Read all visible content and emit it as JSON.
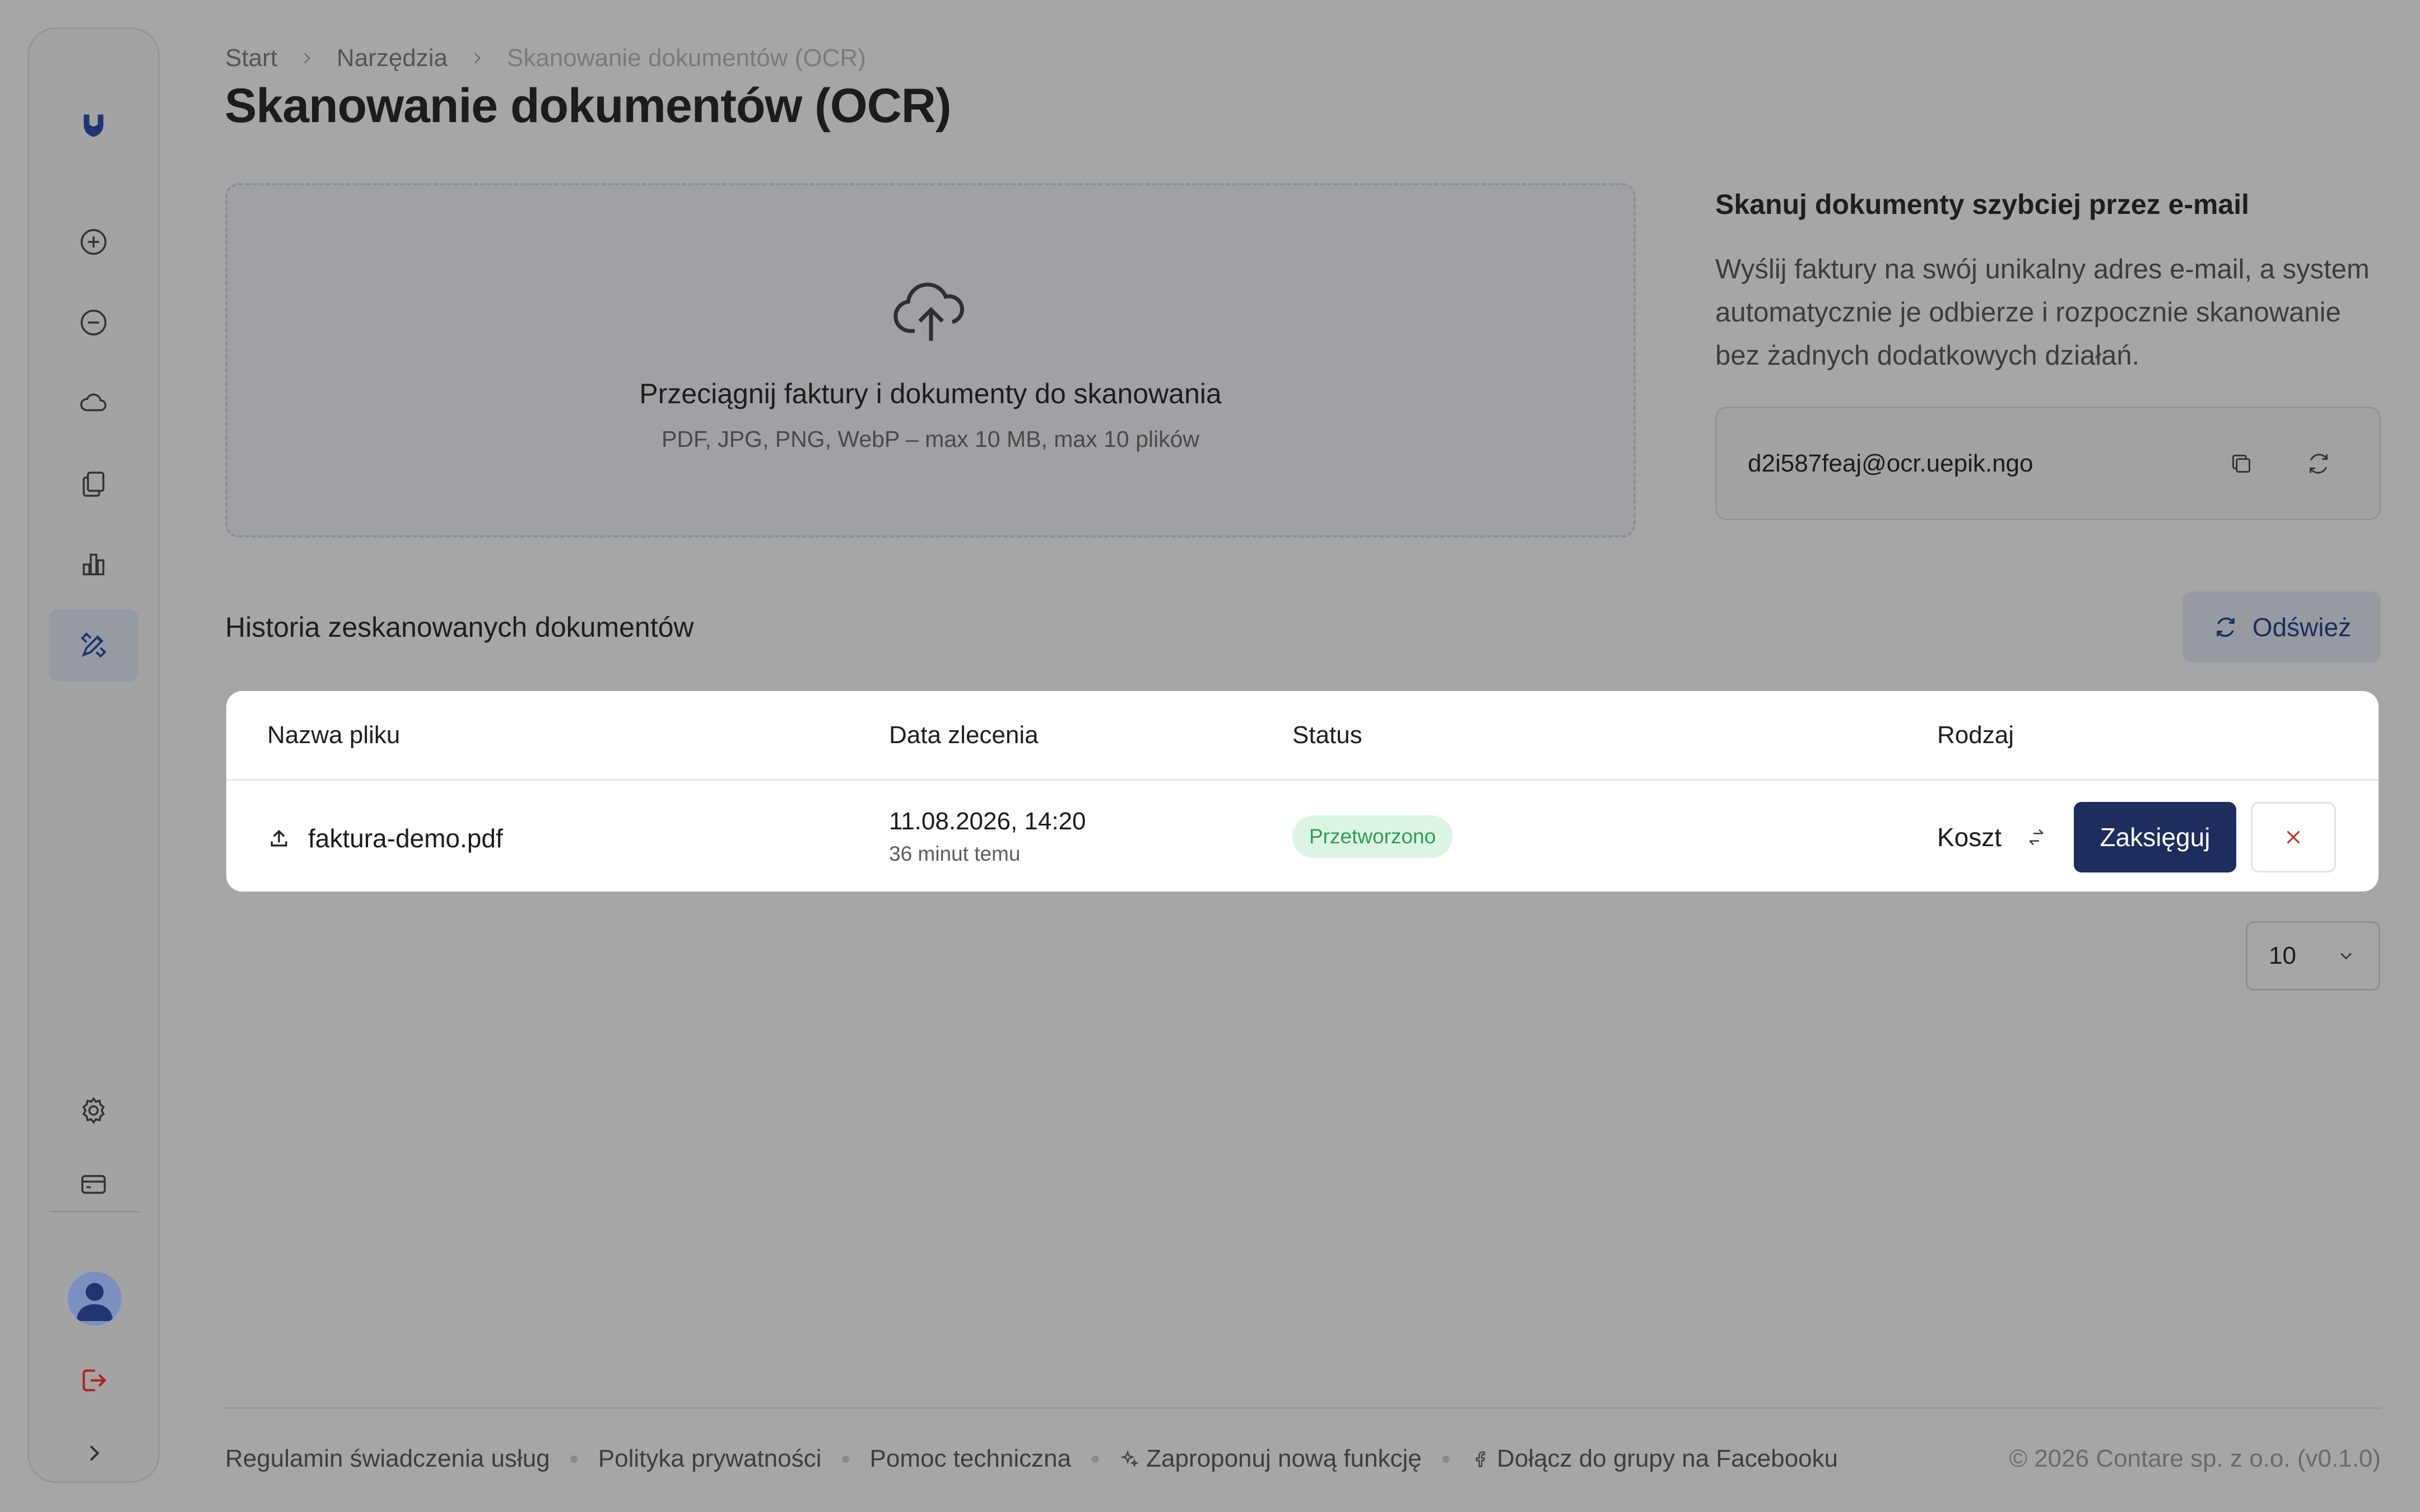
{
  "sidebar": {
    "items": [
      {
        "icon": "logo-icon"
      },
      {
        "icon": "plus-circle-icon"
      },
      {
        "icon": "minus-circle-icon"
      },
      {
        "icon": "cloud-icon"
      },
      {
        "icon": "documents-icon"
      },
      {
        "icon": "chart-bar-icon"
      },
      {
        "icon": "tools-icon",
        "active": true
      },
      {
        "icon": "gear-icon"
      },
      {
        "icon": "card-icon"
      },
      {
        "icon": "logout-icon"
      },
      {
        "icon": "chevron-right-icon"
      }
    ]
  },
  "breadcrumb": {
    "items": [
      "Start",
      "Narzędzia",
      "Skanowanie dokumentów (OCR)"
    ]
  },
  "page": {
    "title": "Skanowanie dokumentów (OCR)"
  },
  "upload": {
    "title": "Przeciągnij faktury i dokumenty do skanowania",
    "subtitle": "PDF, JPG, PNG, WebP – max 10 MB, max 10 plików"
  },
  "email_scan": {
    "title": "Skanuj dokumenty szybciej przez e-mail",
    "description": "Wyślij faktury na swój unikalny adres e-mail, a system automatycznie je odbierze i rozpocznie skanowanie bez żadnych dodatkowych działań.",
    "address": "d2i587feaj@ocr.uepik.ngo"
  },
  "history": {
    "title": "Historia zeskanowanych dokumentów",
    "refresh_label": "Odśwież",
    "columns": [
      "Nazwa pliku",
      "Data zlecenia",
      "Status",
      "Rodzaj"
    ],
    "rows": [
      {
        "file": "faktura-demo.pdf",
        "date": "11.08.2026, 14:20",
        "date_relative": "36 minut temu",
        "status": "Przetworzono",
        "kind": "Koszt",
        "action_label": "Zaksięguj"
      }
    ],
    "page_size": "10"
  },
  "footer": {
    "links": [
      "Regulamin świadczenia usług",
      "Polityka prywatności",
      "Pomoc techniczna",
      "Zaproponuj nową funkcję",
      "Dołącz do grupy na Facebooku"
    ],
    "copyright": "© 2026 Contare sp. z o.o. (v0.1.0)"
  },
  "colors": {
    "accent": "#1c2d5e",
    "status_green": "#2e9e55",
    "danger": "#c0392b"
  }
}
